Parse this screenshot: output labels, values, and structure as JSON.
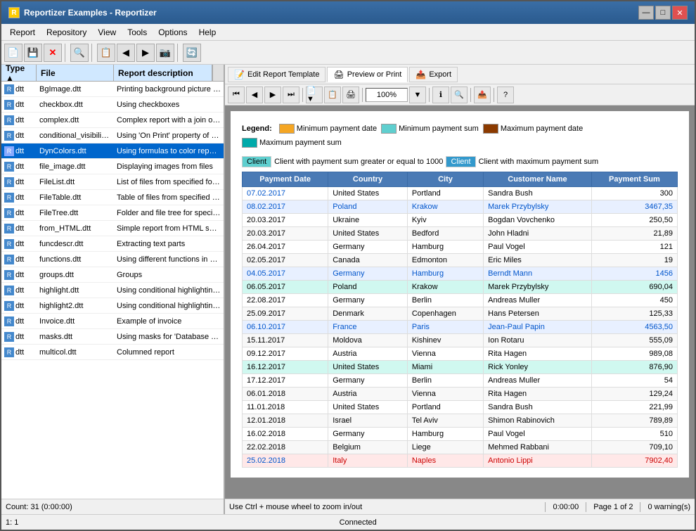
{
  "window": {
    "title": "Reportizer Examples - Reportizer",
    "icon": "R"
  },
  "title_controls": {
    "minimize": "—",
    "maximize": "□",
    "close": "✕"
  },
  "menu": {
    "items": [
      "Report",
      "Repository",
      "View",
      "Tools",
      "Options",
      "Help"
    ]
  },
  "toolbar": {
    "buttons": [
      "📄",
      "💾",
      "✕",
      "🔍",
      "📋",
      "◀",
      "▶",
      "📷",
      "🔄"
    ]
  },
  "report_tabs": {
    "edit": "Edit Report Template",
    "preview": "Preview or Print",
    "export": "Export"
  },
  "left_panel": {
    "headers": {
      "type": "Type ▲",
      "file": "File",
      "description": "Report description"
    },
    "files": [
      {
        "type": "dtt",
        "file": "BgImage.dtt",
        "desc": "Printing background picture on each page"
      },
      {
        "type": "dtt",
        "file": "checkbox.dtt",
        "desc": "Using checkboxes"
      },
      {
        "type": "dtt",
        "file": "complex.dtt",
        "desc": "Complex report with a join of two tables, grouping, database images"
      },
      {
        "type": "dtt",
        "file": "conditional_visibility.dtt",
        "desc": "Using 'On Print' property of the report objects to specify conditional visibility of the objects"
      },
      {
        "type": "dtt",
        "file": "DynColors.dtt",
        "desc": "Using formulas to color report objects depending on database data",
        "selected": true
      },
      {
        "type": "dtt",
        "file": "file_image.dtt",
        "desc": "Displaying images from files"
      },
      {
        "type": "dtt",
        "file": "FileList.dtt",
        "desc": "List of files from specified folder"
      },
      {
        "type": "dtt",
        "file": "FileTable.dtt",
        "desc": "Table of files from specified folder, sorted by type and size"
      },
      {
        "type": "dtt",
        "file": "FileTree.dtt",
        "desc": "Folder and file tree for specified folder"
      },
      {
        "type": "dtt",
        "file": "from_HTML.dtt",
        "desc": "Simple report from HTML source"
      },
      {
        "type": "dtt",
        "file": "funcdescr.dtt",
        "desc": "Extracting text parts"
      },
      {
        "type": "dtt",
        "file": "functions.dtt",
        "desc": "Using different functions in expressions"
      },
      {
        "type": "dtt",
        "file": "groups.dtt",
        "desc": "Groups"
      },
      {
        "type": "dtt",
        "file": "highlight.dtt",
        "desc": "Using conditional highlighting to highlight objects according to predefined criteria"
      },
      {
        "type": "dtt",
        "file": "highlight2.dtt",
        "desc": "Using conditional highlighting to highlight every second row"
      },
      {
        "type": "dtt",
        "file": "Invoice.dtt",
        "desc": "Example of invoice"
      },
      {
        "type": "dtt",
        "file": "masks.dtt",
        "desc": "Using masks for 'Database Text' and 'Expression' objects"
      },
      {
        "type": "dtt",
        "file": "multicol.dtt",
        "desc": "Columned report"
      }
    ],
    "status": "Count: 31 (0:00:00)"
  },
  "legend": {
    "label": "Legend:",
    "items": [
      {
        "id": "min-date",
        "label": "Minimum payment date"
      },
      {
        "id": "max-date",
        "label": "Maximum payment date"
      },
      {
        "id": "min-sum",
        "label": "Minimum payment sum"
      },
      {
        "id": "max-sum",
        "label": "Maximum payment sum"
      }
    ],
    "client_label1": "Client",
    "client_desc1": "Client with payment sum greater or equal to 1000",
    "client_label2": "Client",
    "client_desc2": "Client with maximum payment sum"
  },
  "table": {
    "headers": [
      "Payment Date",
      "Country",
      "City",
      "Customer Name",
      "Payment Sum"
    ],
    "rows": [
      {
        "date": "07.02.2017",
        "country": "United States",
        "city": "Portland",
        "customer": "Sandra Bush",
        "sum": "300",
        "style": "normal"
      },
      {
        "date": "08.02.2017",
        "country": "Poland",
        "city": "Krakow",
        "customer": "Marek Przybylsky",
        "sum": "3467,35",
        "style": "blue"
      },
      {
        "date": "20.03.2017",
        "country": "Ukraine",
        "city": "Kyiv",
        "customer": "Bogdan Vovchenko",
        "sum": "250,50",
        "style": "normal"
      },
      {
        "date": "20.03.2017",
        "country": "United States",
        "city": "Bedford",
        "customer": "John Hladni",
        "sum": "21,89",
        "style": "normal"
      },
      {
        "date": "26.04.2017",
        "country": "Germany",
        "city": "Hamburg",
        "customer": "Paul Vogel",
        "sum": "121",
        "style": "normal"
      },
      {
        "date": "02.05.2017",
        "country": "Canada",
        "city": "Edmonton",
        "customer": "Eric Miles",
        "sum": "19",
        "style": "normal"
      },
      {
        "date": "04.05.2017",
        "country": "Germany",
        "city": "Hamburg",
        "customer": "Berndt Mann",
        "sum": "1456",
        "style": "blue"
      },
      {
        "date": "06.05.2017",
        "country": "Poland",
        "city": "Krakow",
        "customer": "Marek Przybylsky",
        "sum": "690,04",
        "style": "teal"
      },
      {
        "date": "22.08.2017",
        "country": "Germany",
        "city": "Berlin",
        "customer": "Andreas Muller",
        "sum": "450",
        "style": "normal"
      },
      {
        "date": "25.09.2017",
        "country": "Denmark",
        "city": "Copenhagen",
        "customer": "Hans Petersen",
        "sum": "125,33",
        "style": "normal"
      },
      {
        "date": "06.10.2017",
        "country": "France",
        "city": "Paris",
        "customer": "Jean-Paul Papin",
        "sum": "4563,50",
        "style": "blue"
      },
      {
        "date": "15.11.2017",
        "country": "Moldova",
        "city": "Kishinev",
        "customer": "Ion Rotaru",
        "sum": "555,09",
        "style": "normal"
      },
      {
        "date": "09.12.2017",
        "country": "Austria",
        "city": "Vienna",
        "customer": "Rita Hagen",
        "sum": "989,08",
        "style": "normal"
      },
      {
        "date": "16.12.2017",
        "country": "United States",
        "city": "Miami",
        "customer": "Rick Yonley",
        "sum": "876,90",
        "style": "teal"
      },
      {
        "date": "17.12.2017",
        "country": "Germany",
        "city": "Berlin",
        "customer": "Andreas Muller",
        "sum": "54",
        "style": "normal"
      },
      {
        "date": "06.01.2018",
        "country": "Austria",
        "city": "Vienna",
        "customer": "Rita Hagen",
        "sum": "129,24",
        "style": "normal"
      },
      {
        "date": "11.01.2018",
        "country": "United States",
        "city": "Portland",
        "customer": "Sandra Bush",
        "sum": "221,99",
        "style": "normal"
      },
      {
        "date": "12.01.2018",
        "country": "Israel",
        "city": "Tel Aviv",
        "customer": "Shimon Rabinovich",
        "sum": "789,89",
        "style": "normal"
      },
      {
        "date": "16.02.2018",
        "country": "Germany",
        "city": "Hamburg",
        "customer": "Paul Vogel",
        "sum": "510",
        "style": "normal"
      },
      {
        "date": "22.02.2018",
        "country": "Belgium",
        "city": "Liege",
        "customer": "Mehmed Rabbani",
        "sum": "709,10",
        "style": "normal"
      },
      {
        "date": "25.02.2018",
        "country": "Italy",
        "city": "Naples",
        "customer": "Antonio Lippi",
        "sum": "7902,40",
        "style": "blue"
      }
    ]
  },
  "nav": {
    "zoom": "100%",
    "page_info": "Page 1 of 2"
  },
  "status_bar": {
    "hint": "Use Ctrl + mouse wheel to zoom in/out",
    "time": "0:00:00",
    "page": "Page 1 of 2",
    "warnings": "0 warning(s)",
    "position": "1: 1",
    "connection": "Connected"
  }
}
